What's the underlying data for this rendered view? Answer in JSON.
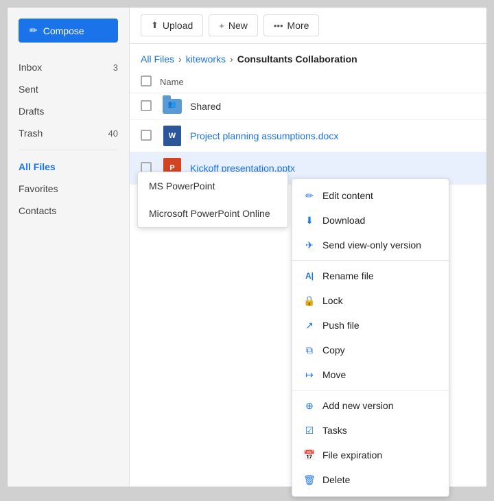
{
  "sidebar": {
    "compose_label": "Compose",
    "nav_items": [
      {
        "id": "inbox",
        "label": "Inbox",
        "badge": "3",
        "active": false
      },
      {
        "id": "sent",
        "label": "Sent",
        "badge": "",
        "active": false
      },
      {
        "id": "drafts",
        "label": "Drafts",
        "badge": "",
        "active": false
      },
      {
        "id": "trash",
        "label": "Trash",
        "badge": "40",
        "active": false
      },
      {
        "id": "all-files",
        "label": "All Files",
        "badge": "",
        "active": true
      },
      {
        "id": "favorites",
        "label": "Favorites",
        "badge": "",
        "active": false
      },
      {
        "id": "contacts",
        "label": "Contacts",
        "badge": "",
        "active": false
      }
    ]
  },
  "toolbar": {
    "upload_label": "Upload",
    "new_label": "New",
    "more_label": "More"
  },
  "breadcrumb": {
    "part1": "All Files",
    "sep1": "›",
    "part2": "kiteworks",
    "sep2": "›",
    "current": "Consultants Collaboration"
  },
  "file_list": {
    "header_name": "Name",
    "files": [
      {
        "id": "shared-folder",
        "name": "Shared",
        "type": "folder"
      },
      {
        "id": "project-planning",
        "name": "Project planning assumptions.docx",
        "type": "word"
      },
      {
        "id": "kickoff-ppt",
        "name": "Kickoff presentation.pptx",
        "type": "ppt"
      }
    ]
  },
  "app_chooser": {
    "items": [
      {
        "id": "ms-powerpoint",
        "label": "MS PowerPoint"
      },
      {
        "id": "ms-powerpoint-online",
        "label": "Microsoft PowerPoint Online"
      }
    ]
  },
  "context_menu": {
    "items": [
      {
        "id": "edit-content",
        "label": "Edit content",
        "icon": "✏️",
        "group": 1
      },
      {
        "id": "download",
        "label": "Download",
        "icon": "⬇",
        "group": 1
      },
      {
        "id": "send-view-only",
        "label": "Send view-only version",
        "icon": "✈",
        "group": 1
      },
      {
        "id": "rename-file",
        "label": "Rename file",
        "icon": "A|",
        "group": 2
      },
      {
        "id": "lock",
        "label": "Lock",
        "icon": "🔒",
        "group": 2
      },
      {
        "id": "push-file",
        "label": "Push file",
        "icon": "↗",
        "group": 2
      },
      {
        "id": "copy",
        "label": "Copy",
        "icon": "⧉",
        "group": 2
      },
      {
        "id": "move",
        "label": "Move",
        "icon": "↦",
        "group": 2
      },
      {
        "id": "add-new-version",
        "label": "Add new version",
        "icon": "⊕",
        "group": 3
      },
      {
        "id": "tasks",
        "label": "Tasks",
        "icon": "☑",
        "group": 3
      },
      {
        "id": "file-expiration",
        "label": "File expiration",
        "icon": "📅",
        "group": 3
      },
      {
        "id": "delete",
        "label": "Delete",
        "icon": "🗑",
        "group": 3
      }
    ]
  }
}
